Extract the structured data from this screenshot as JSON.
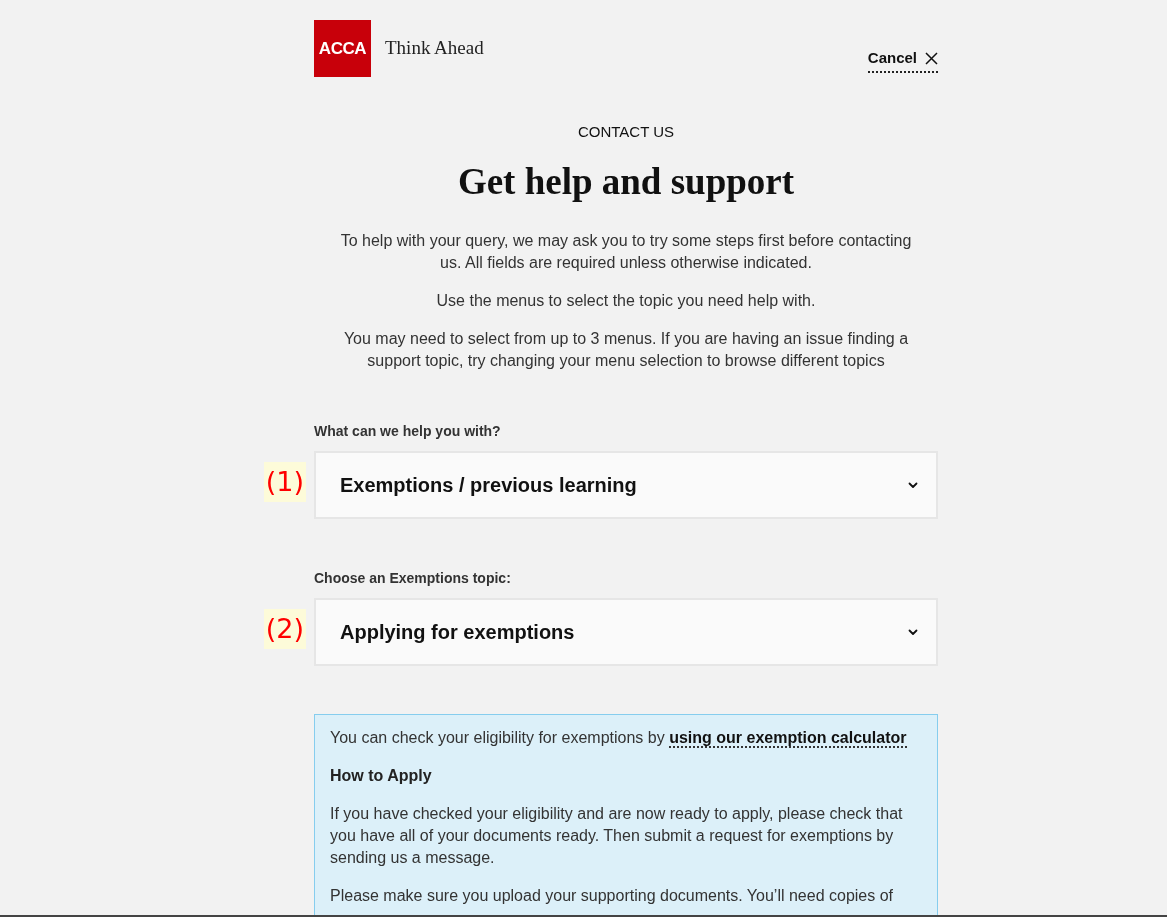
{
  "header": {
    "logo": "ACCA",
    "tagline": "Think Ahead",
    "cancel": "Cancel"
  },
  "eyebrow": "CONTACT US",
  "title": "Get help and support",
  "intro": [
    "To help with your query, we may ask you to try some steps first before contacting us. All fields are required unless otherwise indicated.",
    "Use the menus to select the topic you need help with.",
    "You may need to select from up to 3 menus. If you are having an issue finding a support topic, try changing your menu selection to browse different topics"
  ],
  "selects": [
    {
      "label": "What can we help you with?",
      "value": "Exemptions / previous learning",
      "annotation": "(1)"
    },
    {
      "label": "Choose an Exemptions topic:",
      "value": "Applying for exemptions",
      "annotation": "(2)"
    }
  ],
  "info": {
    "lead": {
      "text": "You can check your eligibility for exemptions by",
      "link": "using our exemption calculator"
    },
    "heading": "How to Apply",
    "paragraphs": [
      "If you have checked your eligibility and are now ready to apply, please check that you have all of your documents ready. Then submit a request for exemptions by sending us a message.",
      "Please make sure you upload your supporting documents. You’ll need copies of"
    ]
  }
}
